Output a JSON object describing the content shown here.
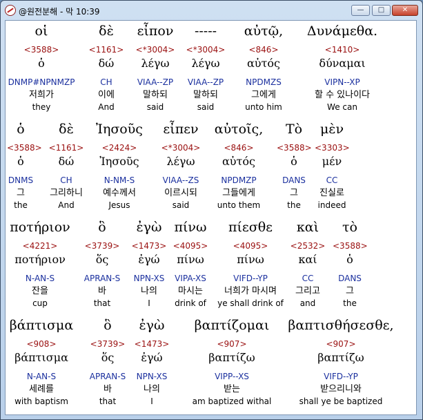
{
  "window": {
    "title": "@원전분해 - 막 10:39",
    "min_glyph": "—",
    "max_glyph": "□",
    "close_glyph": "✕"
  },
  "rows": [
    [
      {
        "greek": "οἱ",
        "num": "<3588>",
        "lemma": "ὁ",
        "parse": "DNMP#NPNMZP",
        "korean": "저희가",
        "english": "they"
      },
      {
        "greek": "δὲ",
        "num": "<1161>",
        "lemma": "δώ",
        "parse": "CH",
        "korean": "이에",
        "english": "And"
      },
      {
        "greek": "εἶπον",
        "num": "<*3004>",
        "lemma": "λέγω",
        "parse": "VIAA--ZP",
        "korean": "말하되",
        "english": "said"
      },
      {
        "greek": "-----",
        "num": "<*3004>",
        "lemma": "λέγω",
        "parse": "VIAA--ZP",
        "korean": "말하되",
        "english": "said"
      },
      {
        "greek": "αὐτῷ,",
        "num": "<846>",
        "lemma": "αὐτός",
        "parse": "NPDMZS",
        "korean": "그에게",
        "english": "unto him"
      },
      {
        "greek": "Δυνάμεθα.",
        "num": "<1410>",
        "lemma": "δύναμαι",
        "parse": "VIPN--XP",
        "korean": "할 수 있나이다",
        "english": "We can"
      }
    ],
    [
      {
        "greek": "ὁ",
        "num": "<3588>",
        "lemma": "ὁ",
        "parse": "DNMS",
        "korean": "그",
        "english": "the"
      },
      {
        "greek": "δὲ",
        "num": "<1161>",
        "lemma": "δώ",
        "parse": "CH",
        "korean": "그리하니",
        "english": "And"
      },
      {
        "greek": "Ἰησοῦς",
        "num": "<2424>",
        "lemma": "Ἰησοῦς",
        "parse": "N-NM-S",
        "korean": "예수께서",
        "english": "Jesus"
      },
      {
        "greek": "εἶπεν",
        "num": "<*3004>",
        "lemma": "λέγω",
        "parse": "VIAA--ZS",
        "korean": "이르시되",
        "english": "said"
      },
      {
        "greek": "αὐτοῖς,",
        "num": "<846>",
        "lemma": "αὐτός",
        "parse": "NPDMZP",
        "korean": "그들에게",
        "english": "unto them"
      },
      {
        "greek": "Τὸ",
        "num": "<3588>",
        "lemma": "ὁ",
        "parse": "DANS",
        "korean": "그",
        "english": "the"
      },
      {
        "greek": "μὲν",
        "num": "<3303>",
        "lemma": "μέν",
        "parse": "CC",
        "korean": "진실로",
        "english": "indeed"
      }
    ],
    [
      {
        "greek": "ποτήριον",
        "num": "<4221>",
        "lemma": "ποτήριον",
        "parse": "N-AN-S",
        "korean": "잔을",
        "english": "cup"
      },
      {
        "greek": "ὃ",
        "num": "<3739>",
        "lemma": "ὅς",
        "parse": "APRAN-S",
        "korean": "바",
        "english": "that"
      },
      {
        "greek": "ἐγὼ",
        "num": "<1473>",
        "lemma": "ἐγώ",
        "parse": "NPN-XS",
        "korean": "나의",
        "english": "I"
      },
      {
        "greek": "πίνω",
        "num": "<4095>",
        "lemma": "πίνω",
        "parse": "VIPA-XS",
        "korean": "마시는",
        "english": "drink of"
      },
      {
        "greek": "πίεσθε",
        "num": "<4095>",
        "lemma": "πίνω",
        "parse": "VIFD--YP",
        "korean": "너희가 마시며",
        "english": "ye shall drink of"
      },
      {
        "greek": "καὶ",
        "num": "<2532>",
        "lemma": "καί",
        "parse": "CC",
        "korean": "그리고",
        "english": "and"
      },
      {
        "greek": "τὸ",
        "num": "<3588>",
        "lemma": "ὁ",
        "parse": "DANS",
        "korean": "그",
        "english": "the"
      }
    ],
    [
      {
        "greek": "βάπτισμα",
        "num": "<908>",
        "lemma": "βάπτισμα",
        "parse": "N-AN-S",
        "korean": "세례를",
        "english": "with baptism"
      },
      {
        "greek": "ὃ",
        "num": "<3739>",
        "lemma": "ὅς",
        "parse": "APRAN-S",
        "korean": "바",
        "english": "that"
      },
      {
        "greek": "ἐγὼ",
        "num": "<1473>",
        "lemma": "ἐγώ",
        "parse": "NPN-XS",
        "korean": "나의",
        "english": "I"
      },
      {
        "greek": "βαπτίζομαι",
        "num": "<907>",
        "lemma": "βαπτίζω",
        "parse": "VIPP--XS",
        "korean": "받는",
        "english": "am baptized withal"
      },
      {
        "greek": "βαπτισθήσεσθε,",
        "num": "<907>",
        "lemma": "βαπτίζω",
        "parse": "VIFD--YP",
        "korean": "받으리니와",
        "english": "shall ye be baptized"
      }
    ]
  ]
}
